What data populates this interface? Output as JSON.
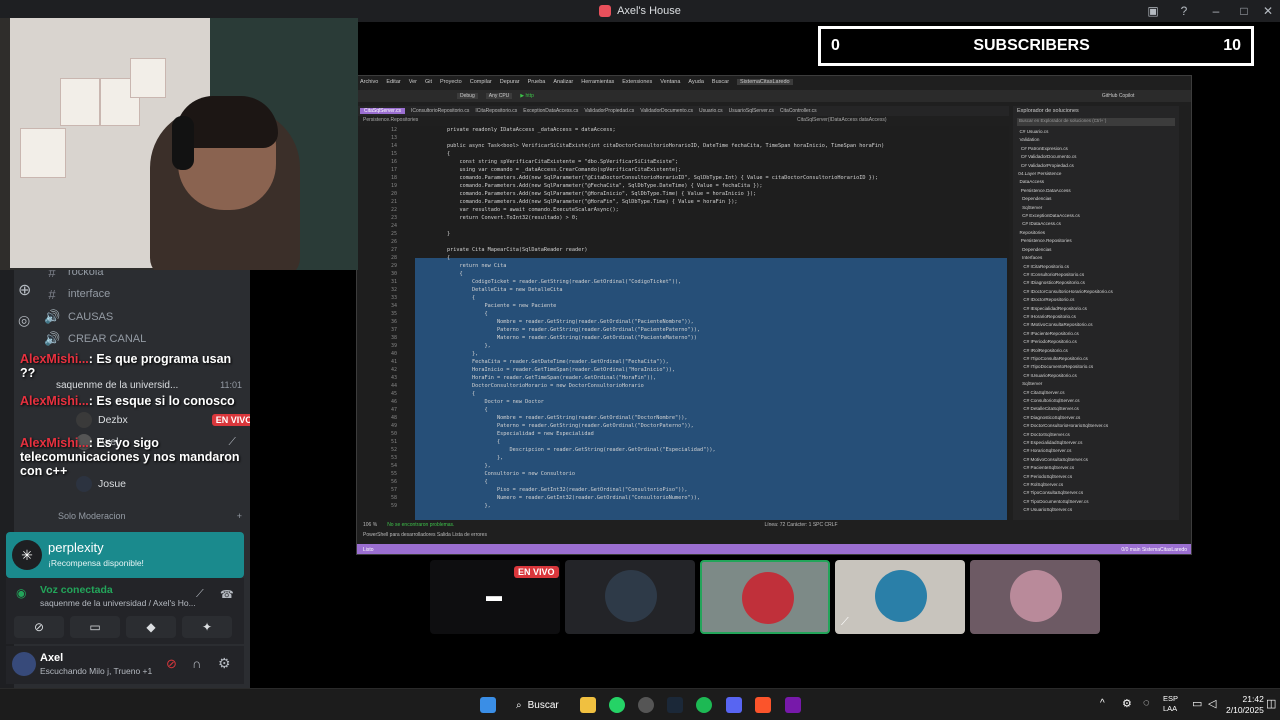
{
  "window": {
    "title": "Axel's House"
  },
  "subscriber_bar": {
    "start": "0",
    "label": "SUBSCRIBERS",
    "goal": "10"
  },
  "channels": [
    {
      "glyph": "#",
      "name": "rockola"
    },
    {
      "glyph": "#",
      "name": "interface"
    },
    {
      "glyph": "🔊",
      "name": "CAUSAS"
    },
    {
      "glyph": "🔊",
      "name": "CREAR CANAL"
    }
  ],
  "voice_channel": {
    "name": "saquenme de la universid...",
    "time": "11:01"
  },
  "voice_users": [
    {
      "name": "Dezbx",
      "badge": "EN VIVO"
    },
    {
      "name": "Axel"
    },
    {
      "name": "Josue"
    }
  ],
  "chat": [
    {
      "user": "AlexMishi...",
      "text": ": Es que programa usan ??"
    },
    {
      "user": "AlexMishi...",
      "text": ": Es esque si lo conosco"
    },
    {
      "user": "AlexMishi...",
      "text": ": Es yo sigo telecomunicaciones y nos mandaron con c++"
    }
  ],
  "moderation_label": "Solo Moderacion",
  "perplexity": {
    "name": "perplexity",
    "sub": "¡Recompensa disponible!"
  },
  "voice_panel": {
    "status": "Voz conectada",
    "where": "saquenme de la universidad / Axel's Ho..."
  },
  "user": {
    "name": "Axel",
    "status": "Escuchando Milo j, Trueno +1"
  },
  "vs": {
    "menu": [
      "Archivo",
      "Editar",
      "Ver",
      "Git",
      "Proyecto",
      "Compilar",
      "Depurar",
      "Prueba",
      "Analizar",
      "Herramientas",
      "Extensiones",
      "Ventana",
      "Ayuda",
      "Buscar",
      "SistemaCitasLaredo"
    ],
    "toolbar": [
      "Debug",
      "Any CPU",
      "http",
      "GitHub Copilot"
    ],
    "tabs": [
      "CitaSqlServer.cs",
      "IConsultorioRepositorio.cs",
      "ICitaRepositorio.cs",
      "ExceptionDataAccess.cs",
      "ValidadorPropiedad.cs",
      "ValidadorDocumento.cs",
      "Usuario.cs",
      "UsuarioSqlServer.cs",
      "CitaController.cs"
    ],
    "breadcrumb": "Persistence.Repositories",
    "breadcrumb_right": "CitaSqlServer(IDataAccess dataAccess)",
    "line_numbers": "12\n13\n14\n15\n16\n17\n18\n19\n20\n21\n22\n23\n24\n25\n26\n27\n28\n29\n30\n31\n32\n33\n34\n35\n36\n37\n38\n39\n40\n41\n42\n43\n44\n45\n46\n47\n48\n49\n50\n51\n52\n53\n54\n55\n56\n57\n58\n59",
    "code": "private readonly IDataAccess _dataAccess = dataAccess;\n\npublic async Task<bool> VerificarSiCitaExiste(int citaDoctorConsultorioHorarioID, DateTime fechaCita, TimeSpan horaInicio, TimeSpan horaFin)\n{\n    const string spVerificarCitaExistente = \"dbo.SpVerificarSiCitaExiste\";\n    using var comando = _dataAccess.CrearComando(spVerificarCitaExistente);\n    comando.Parameters.Add(new SqlParameter(\"@CitaDoctorConsultorioHorarioID\", SqlDbType.Int) { Value = citaDoctorConsultorioHorarioID });\n    comando.Parameters.Add(new SqlParameter(\"@FechaCita\", SqlDbType.DateTime) { Value = fechaCita });\n    comando.Parameters.Add(new SqlParameter(\"@HoraInicio\", SqlDbType.Time) { Value = horaInicio });\n    comando.Parameters.Add(new SqlParameter(\"@HoraFin\", SqlDbType.Time) { Value = horaFin });\n    var resultado = await comando.ExecuteScalarAsync();\n    return Convert.ToInt32(resultado) > 0;\n\n}\n\nprivate Cita MapearCita(SqlDataReader reader)\n{\n    return new Cita\n    {\n        CodigoTicket = reader.GetString(reader.GetOrdinal(\"CodigoTicket\")),\n        DetalleCita = new DetalleCita\n        {\n            Paciente = new Paciente\n            {\n                Nombre = reader.GetString(reader.GetOrdinal(\"PacienteNombre\")),\n                Paterno = reader.GetString(reader.GetOrdinal(\"PacientePaterno\")),\n                Materno = reader.GetString(reader.GetOrdinal(\"PacienteMaterno\"))\n            },\n        },\n        FechaCita = reader.GetDateTime(reader.GetOrdinal(\"FechaCita\")),\n        HoraInicio = reader.GetTimeSpan(reader.GetOrdinal(\"HoraInicio\")),\n        HoraFin = reader.GetTimeSpan(reader.GetOrdinal(\"HoraFin\")),\n        DoctorConsultorioHorario = new DoctorConsultorioHorario\n        {\n            Doctor = new Doctor\n            {\n                Nombre = reader.GetString(reader.GetOrdinal(\"DoctorNombre\")),\n                Paterno = reader.GetString(reader.GetOrdinal(\"DoctorPaterno\")),\n                Especialidad = new Especialidad\n                {\n                    Descripcion = reader.GetString(reader.GetOrdinal(\"Especialidad\")),\n                },\n            },\n            Consultorio = new Consultorio\n            {\n                Piso = reader.GetInt32(reader.GetOrdinal(\"ConsultorioPiso\")),\n                Numero = reader.GetInt32(reader.GetOrdinal(\"ConsultorioNumero\")),\n            },",
    "solution_explorer": {
      "title": "Explorador de soluciones",
      "search": "Buscar en Explorador de soluciones (Ctrl+`)",
      "tree": "  C# Usuario.cs\n  Validation\n   C# PatronExpresion.cs\n   C# ValidadorDocumento.cs\n   C# ValidadorPropiedad.cs\n 04.Layer Persistence\n  DataAccess\n   Persistence.DataAccess\n    Dependencias\n    SqlServer\n    C# ExceptionDataAccess.cs\n    C# IDataAccess.cs\n  Repositories\n   Persistence.Repositories\n    Dependencias\n    Interfaces\n     C# ICitaRepositorio.cs\n     C# IConsultorioRepositorio.cs\n     C# IDiagnosticoRepositorio.cs\n     C# IDoctorConsultorioHorarioRepositorio.cs\n     C# IDoctorRepositorio.cs\n     C# IEspecialidadRepositorio.cs\n     C# IHorarioRepositorio.cs\n     C# IMotivoConsultaRepositorio.cs\n     C# IPacienteRepositorio.cs\n     C# IPeriodoRepositorio.cs\n     C# IRolRepositorio.cs\n     C# ITipoConsultaRepositorio.cs\n     C# ITipoDocumentoRepositorio.cs\n     C# IUsuarioRepositorio.cs\n    SqlServer\n     C# CitaSqlServer.cs\n     C# ConsultorioSqlServer.cs\n     C# DetalleCitaSqlServer.cs\n     C# DiagnosticoSqlServer.cs\n     C# DoctorConsultorioHorarioSqlServer.cs\n     C# DoctorSqlServer.cs\n     C# EspecialidadSqlServer.cs\n     C# HorarioSqlServer.cs\n     C# MotivoConsultaSqlServer.cs\n     C# PacienteSqlServer.cs\n     C# PeriodoSqlServer.cs\n     C# RolSqlServer.cs\n     C# TipoConsultaSqlServer.cs\n     C# TipoDocumentoSqlServer.cs\n     C# UsuarioSqlServer.cs"
    },
    "editor_status": {
      "zoom": "106 %",
      "problems": "No se encontraron problemas.",
      "position": "Línea: 72   Carácter: 1   SPC   CRLF"
    },
    "bottom_tabs": "PowerShell para desarrolladores   Salida   Lista de errores",
    "statusbar": {
      "left": "Listo",
      "right": "0/0   main   SistemaCitasLaredo"
    }
  },
  "tiles": [
    {
      "badge": "EN VIVO"
    }
  ],
  "taskbar": {
    "search": "Buscar",
    "lang": "ESP\nLAA",
    "time": "21:42",
    "date": "2/10/2025"
  }
}
